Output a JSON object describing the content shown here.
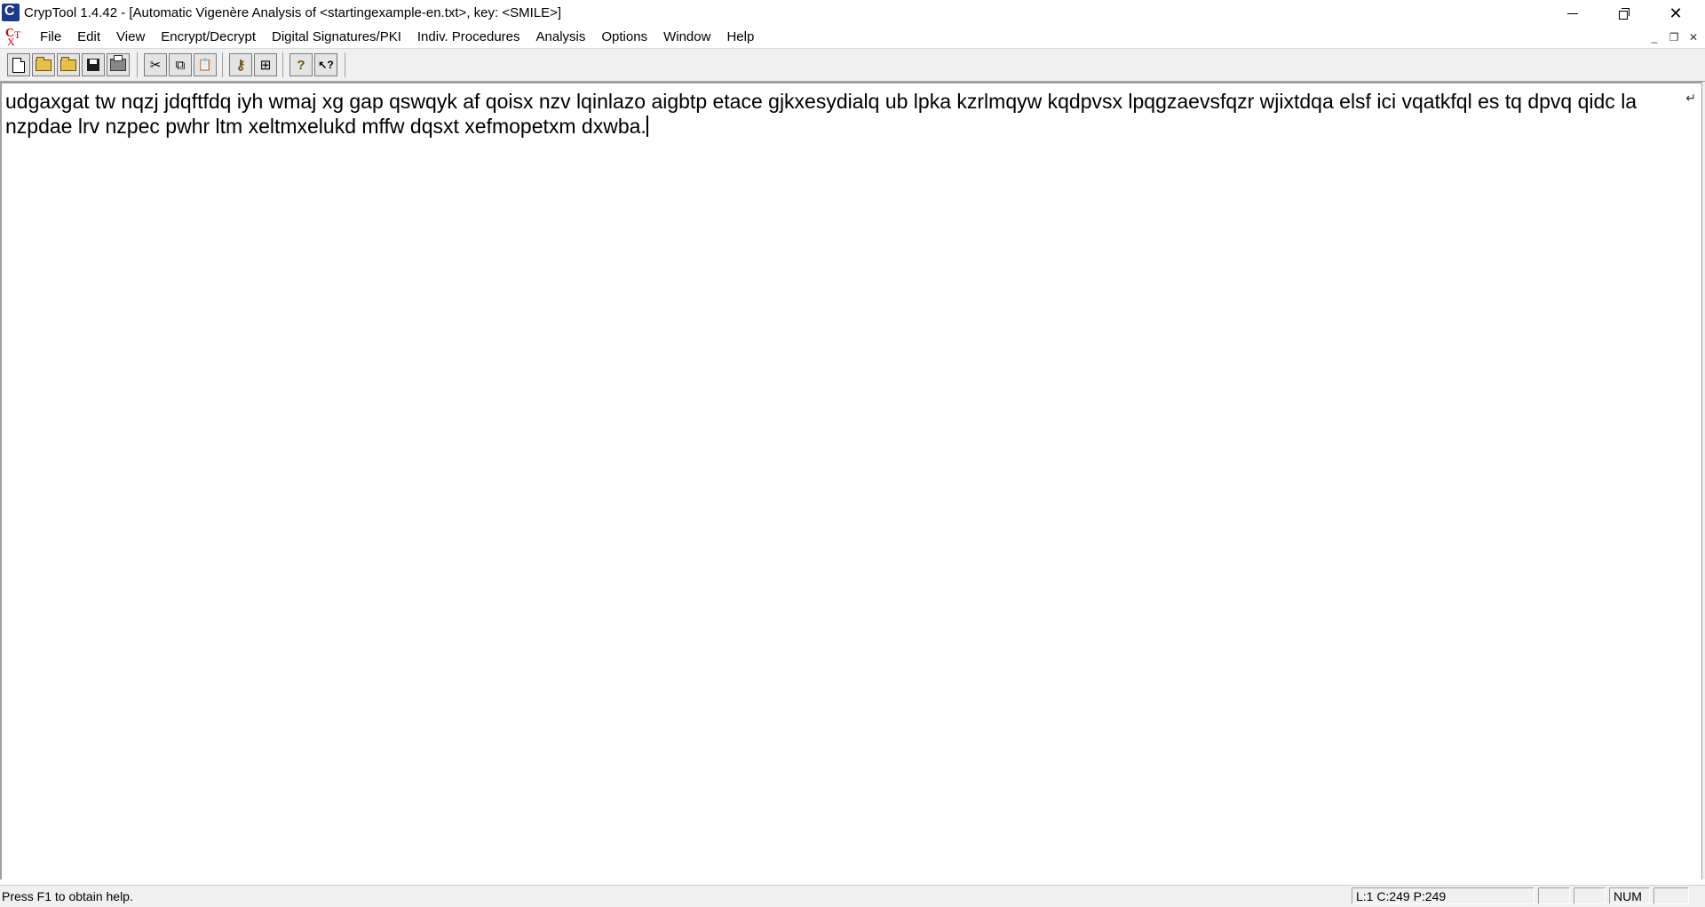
{
  "window": {
    "title": "CrypTool 1.4.42 - [Automatic Vigenère Analysis of <startingexample-en.txt>, key: <SMILE>]",
    "app_icon_letter": "C",
    "minimize": "—",
    "close": "✕"
  },
  "menubar": {
    "logo_c": "C",
    "logo_t": "T",
    "logo_x": "X",
    "items": [
      "File",
      "Edit",
      "View",
      "Encrypt/Decrypt",
      "Digital Signatures/PKI",
      "Indiv. Procedures",
      "Analysis",
      "Options",
      "Window",
      "Help"
    ],
    "mdi_minimize": "_",
    "mdi_restore": "❐",
    "mdi_close": "✕"
  },
  "toolbar": {
    "icons": [
      "new-document-icon",
      "open-folder-icon",
      "open-folder-alt-icon",
      "save-icon",
      "print-icon",
      "cut-icon",
      "copy-icon",
      "paste-icon",
      "key-icon",
      "window-icon",
      "help-icon",
      "context-help-icon"
    ],
    "cut_glyph": "✂",
    "copy_glyph": "⧉",
    "paste_glyph": "📋",
    "key_glyph": "⚷",
    "window_glyph": "⊞",
    "help_glyph": "?",
    "context_help_glyph": "↖?"
  },
  "editor": {
    "text": "udgaxgat tw nqzj jdqftfdq iyh wmaj xg gap qswqyk af qoisx nzv lqinlazo aigbtp etace gjkxesydialq ub lpka kzrlmqyw kqdpvsx lpqgzaevsfqzr wjixtdqa elsf ici vqatkfql es tq dpvq qidc la nzpdae lrv nzpec pwhr ltm xeltmxelukd mffw dqsxt xefmopetxm dxwba.",
    "wrap_mark": "↵"
  },
  "statusbar": {
    "message": "Press F1 to obtain help.",
    "position": "L:1  C:249  P:249",
    "num": "NUM"
  }
}
